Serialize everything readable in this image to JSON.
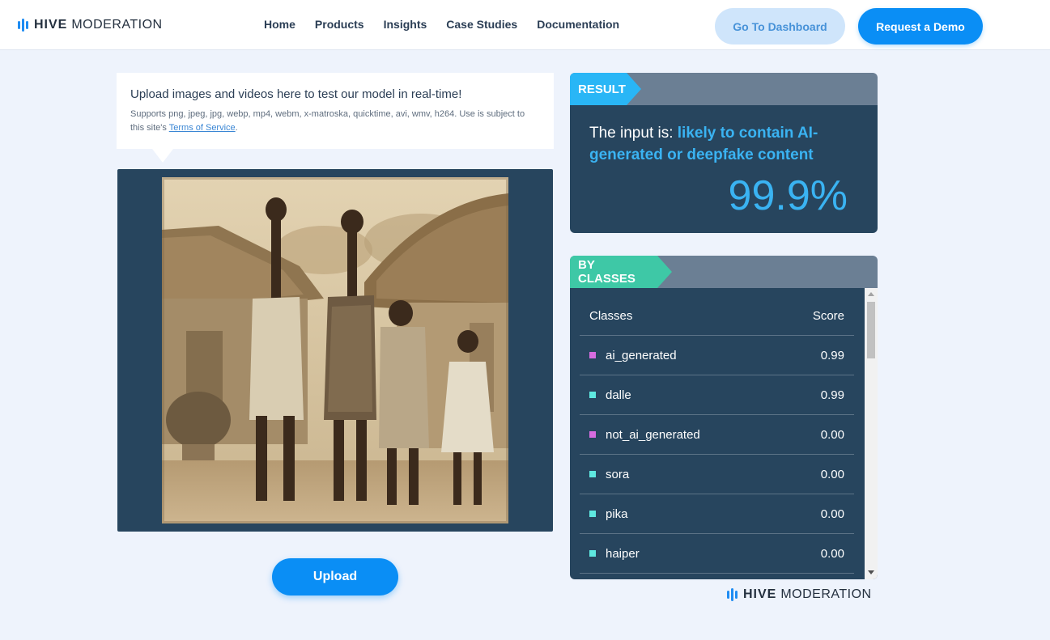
{
  "brand": {
    "hive": "HIVE",
    "moderation": "MODERATION",
    "brand_color": "#1f8cf2"
  },
  "nav": {
    "links": [
      "Home",
      "Products",
      "Insights",
      "Case Studies",
      "Documentation"
    ],
    "dashboard_button": "Go To Dashboard",
    "demo_button": "Request a Demo"
  },
  "upload_info": {
    "title": "Upload images and videos here to test our model in real-time!",
    "subtitle": "Supports png, jpeg, jpg, webp, mp4, webm, x-matroska, quicktime, avi, wmv, h264. Use is subject to this site's ",
    "terms_link": "Terms of Service",
    "period": "."
  },
  "upload_button": "Upload",
  "result": {
    "tag": "RESULT",
    "prefix": "The input is: ",
    "verdict": "likely to contain AI-generated or deepfake content",
    "score": "99.9%",
    "accent_color": "#29b6f6"
  },
  "by_classes": {
    "tag": "BY CLASSES",
    "header_classes": "Classes",
    "header_score": "Score",
    "accent_color": "#3ec8a6",
    "rows": [
      {
        "name": "ai_generated",
        "score": "0.99",
        "color": "#d66ce0"
      },
      {
        "name": "dalle",
        "score": "0.99",
        "color": "#5ee8e0"
      },
      {
        "name": "not_ai_generated",
        "score": "0.00",
        "color": "#d66ce0"
      },
      {
        "name": "sora",
        "score": "0.00",
        "color": "#5ee8e0"
      },
      {
        "name": "pika",
        "score": "0.00",
        "color": "#5ee8e0"
      },
      {
        "name": "haiper",
        "score": "0.00",
        "color": "#5ee8e0"
      }
    ]
  }
}
